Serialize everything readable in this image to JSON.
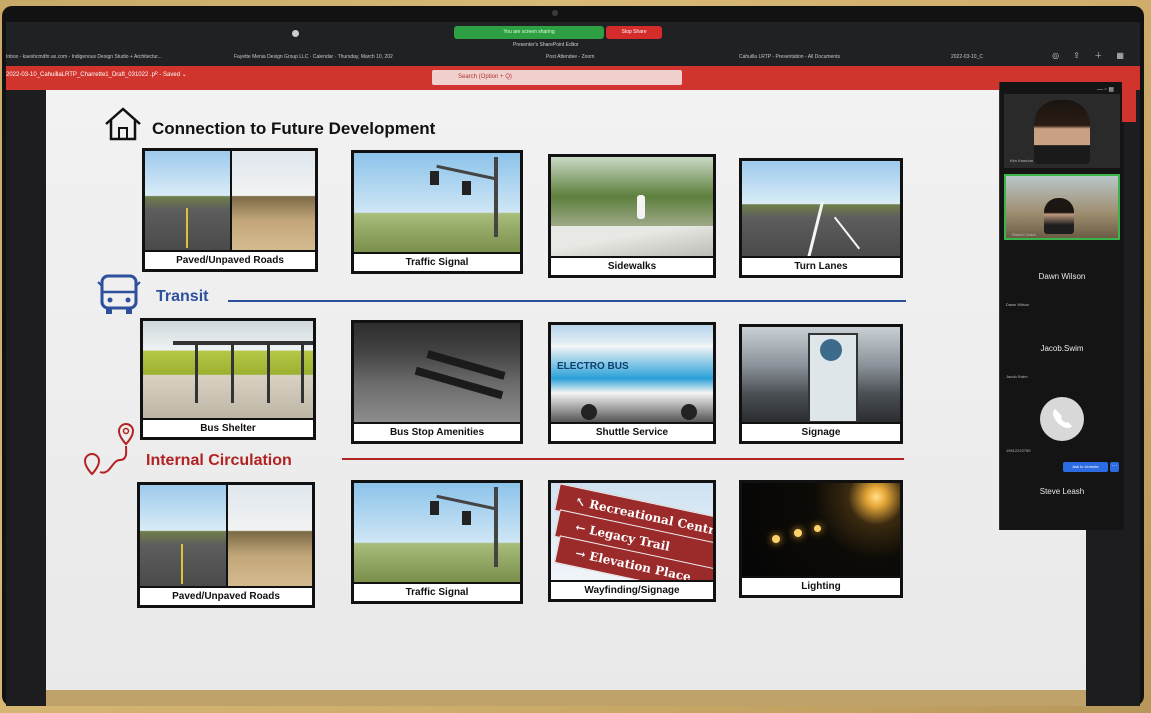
{
  "browser": {
    "sharing_indicator": "You are screen sharing",
    "stop_share_label": "Stop Share",
    "screen_note": "Presenter's SharePoint Editor",
    "tabs": [
      {
        "label": "Inbox - kaeshcmdhr.ax.com - Indigenous Design Studio + Architectur..."
      },
      {
        "label": "Fayette Menia Design Group LLC · Calendar · Thursday, March 10, 202"
      },
      {
        "label": "Post Attendee - Zoom"
      },
      {
        "label": "Cahuilla LRTP - Presentation - All Documents"
      },
      {
        "label": "2022-03-10_C"
      }
    ]
  },
  "app": {
    "doc_title": "2022-03-10_CahuillaLRTP_Charrette1_Draft_031022 .pᴿ - Saved ⌄",
    "search_placeholder": "Search (Option + Q)"
  },
  "slide": {
    "sections": [
      {
        "title": "Connection to Future Development",
        "icon": "house-icon",
        "cards": [
          "Paved/Unpaved Roads",
          "Traffic Signal",
          "Sidewalks",
          "Turn Lanes"
        ]
      },
      {
        "title": "Transit",
        "icon": "bus-icon",
        "color": "#2d4f9e",
        "cards": [
          "Bus Shelter",
          "Bus Stop Amenities",
          "Shuttle Service",
          "Signage"
        ]
      },
      {
        "title": "Internal Circulation",
        "icon": "route-pin-icon",
        "color": "#b22222",
        "cards": [
          "Paved/Unpaved Roads",
          "Traffic Signal",
          "Wayfinding/Signage",
          "Lighting"
        ]
      }
    ],
    "wayfinding_sign": [
      "Recreational Centre",
      "Legacy Trail",
      "Elevation Place"
    ],
    "bus_text": "ELECTRO BUS"
  },
  "zoom": {
    "participants": [
      {
        "name": "Kim Kamuha",
        "type": "video"
      },
      {
        "name": "Rachel Grant",
        "type": "video"
      },
      {
        "name": "Dawn Wilson",
        "type": "name",
        "sub": "Dawn Wilson"
      },
      {
        "name": "Jacob.Swim",
        "type": "name",
        "sub": "Jacob.Swim"
      },
      {
        "name": "Steve Leash",
        "type": "name",
        "sub": "19512222759"
      }
    ],
    "ask_unmute_label": "Ask to Unmute",
    "more_label": "···"
  },
  "colors": {
    "app_red": "#d0342c",
    "transit_blue": "#2d4f9e",
    "circulation_red": "#b22222"
  }
}
